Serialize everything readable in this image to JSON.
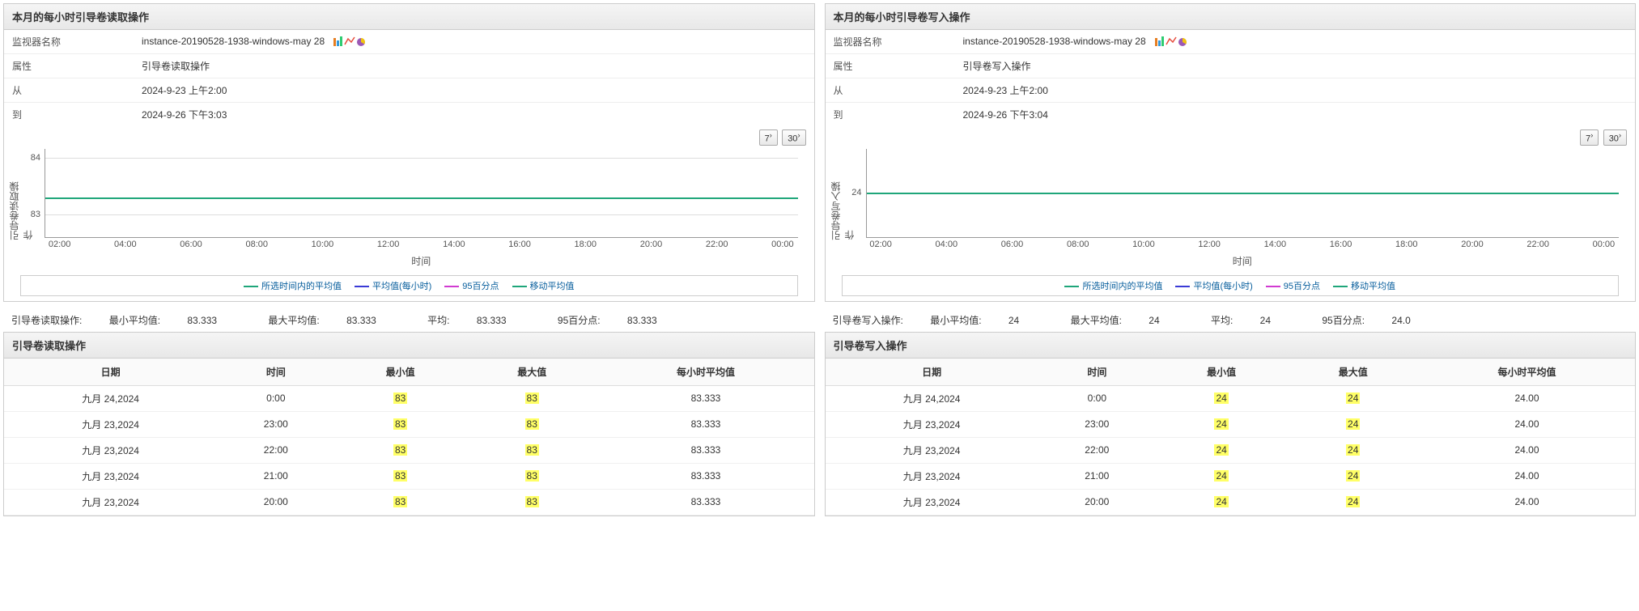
{
  "left": {
    "header": "本月的每小时引导卷读取操作",
    "info": {
      "monitor_label": "监视器名称",
      "monitor_value": "instance-20190528-1938-windows-may 28",
      "attr_label": "属性",
      "attr_value": "引导卷读取操作",
      "from_label": "从",
      "from_value": "2024-9-23 上午2:00",
      "to_label": "到",
      "to_value": "2024-9-26 下午3:03"
    },
    "toolbar": {
      "btn7": "7",
      "btn30": "30"
    },
    "chart": {
      "yaxis_label": "引导卷读取操作",
      "yticks": [
        "83",
        "84"
      ],
      "xticks": [
        "02:00",
        "04:00",
        "06:00",
        "08:00",
        "10:00",
        "12:00",
        "14:00",
        "16:00",
        "18:00",
        "20:00",
        "22:00",
        "00:00"
      ],
      "xlabel": "时间"
    },
    "legend": [
      {
        "label": "所选时间内的平均值",
        "color": "#1fa67a"
      },
      {
        "label": "平均值(每小时)",
        "color": "#3b3bd6"
      },
      {
        "label": "95百分点",
        "color": "#d13bd1"
      },
      {
        "label": "移动平均值",
        "color": "#1fa67a"
      }
    ],
    "stats": {
      "prefix": "引导卷读取操作:",
      "min_label": "最小平均值:",
      "min_value": "83.333",
      "max_label": "最大平均值:",
      "max_value": "83.333",
      "avg_label": "平均:",
      "avg_value": "83.333",
      "p95_label": "95百分点:",
      "p95_value": "83.333"
    },
    "table_header": "引导卷读取操作",
    "columns": {
      "date": "日期",
      "time": "时间",
      "min": "最小值",
      "max": "最大值",
      "havg": "每小时平均值"
    },
    "rows": [
      {
        "date": "九月 24,2024",
        "time": "0:00",
        "min": "83",
        "max": "83",
        "havg": "83.333"
      },
      {
        "date": "九月 23,2024",
        "time": "23:00",
        "min": "83",
        "max": "83",
        "havg": "83.333"
      },
      {
        "date": "九月 23,2024",
        "time": "22:00",
        "min": "83",
        "max": "83",
        "havg": "83.333"
      },
      {
        "date": "九月 23,2024",
        "time": "21:00",
        "min": "83",
        "max": "83",
        "havg": "83.333"
      },
      {
        "date": "九月 23,2024",
        "time": "20:00",
        "min": "83",
        "max": "83",
        "havg": "83.333"
      }
    ]
  },
  "right": {
    "header": "本月的每小时引导卷写入操作",
    "info": {
      "monitor_label": "监视器名称",
      "monitor_value": "instance-20190528-1938-windows-may 28",
      "attr_label": "属性",
      "attr_value": "引导卷写入操作",
      "from_label": "从",
      "from_value": "2024-9-23 上午2:00",
      "to_label": "到",
      "to_value": "2024-9-26 下午3:04"
    },
    "toolbar": {
      "btn7": "7",
      "btn30": "30"
    },
    "chart": {
      "yaxis_label": "引导卷写入操作",
      "yticks": [
        "24"
      ],
      "xticks": [
        "02:00",
        "04:00",
        "06:00",
        "08:00",
        "10:00",
        "12:00",
        "14:00",
        "16:00",
        "18:00",
        "20:00",
        "22:00",
        "00:00"
      ],
      "xlabel": "时间"
    },
    "legend": [
      {
        "label": "所选时间内的平均值",
        "color": "#1fa67a"
      },
      {
        "label": "平均值(每小时)",
        "color": "#3b3bd6"
      },
      {
        "label": "95百分点",
        "color": "#d13bd1"
      },
      {
        "label": "移动平均值",
        "color": "#1fa67a"
      }
    ],
    "stats": {
      "prefix": "引导卷写入操作:",
      "min_label": "最小平均值:",
      "min_value": "24",
      "max_label": "最大平均值:",
      "max_value": "24",
      "avg_label": "平均:",
      "avg_value": "24",
      "p95_label": "95百分点:",
      "p95_value": "24.0"
    },
    "table_header": "引导卷写入操作",
    "columns": {
      "date": "日期",
      "time": "时间",
      "min": "最小值",
      "max": "最大值",
      "havg": "每小时平均值"
    },
    "rows": [
      {
        "date": "九月 24,2024",
        "time": "0:00",
        "min": "24",
        "max": "24",
        "havg": "24.00"
      },
      {
        "date": "九月 23,2024",
        "time": "23:00",
        "min": "24",
        "max": "24",
        "havg": "24.00"
      },
      {
        "date": "九月 23,2024",
        "time": "22:00",
        "min": "24",
        "max": "24",
        "havg": "24.00"
      },
      {
        "date": "九月 23,2024",
        "time": "21:00",
        "min": "24",
        "max": "24",
        "havg": "24.00"
      },
      {
        "date": "九月 23,2024",
        "time": "20:00",
        "min": "24",
        "max": "24",
        "havg": "24.00"
      }
    ]
  },
  "chart_data": [
    {
      "type": "line",
      "title": "本月的每小时引导卷读取操作",
      "xlabel": "时间",
      "ylabel": "引导卷读取操作",
      "ylim": [
        83,
        84
      ],
      "categories": [
        "02:00",
        "04:00",
        "06:00",
        "08:00",
        "10:00",
        "12:00",
        "14:00",
        "16:00",
        "18:00",
        "20:00",
        "22:00",
        "00:00"
      ],
      "series": [
        {
          "name": "所选时间内的平均值",
          "values": [
            83.333,
            83.333,
            83.333,
            83.333,
            83.333,
            83.333,
            83.333,
            83.333,
            83.333,
            83.333,
            83.333,
            83.333
          ]
        },
        {
          "name": "平均值(每小时)",
          "values": [
            83.333,
            83.333,
            83.333,
            83.333,
            83.333,
            83.333,
            83.333,
            83.333,
            83.333,
            83.333,
            83.333,
            83.333
          ]
        },
        {
          "name": "95百分点",
          "values": [
            83.333,
            83.333,
            83.333,
            83.333,
            83.333,
            83.333,
            83.333,
            83.333,
            83.333,
            83.333,
            83.333,
            83.333
          ]
        },
        {
          "name": "移动平均值",
          "values": [
            83.333,
            83.333,
            83.333,
            83.333,
            83.333,
            83.333,
            83.333,
            83.333,
            83.333,
            83.333,
            83.333,
            83.333
          ]
        }
      ]
    },
    {
      "type": "line",
      "title": "本月的每小时引导卷写入操作",
      "xlabel": "时间",
      "ylabel": "引导卷写入操作",
      "ylim": [
        23.5,
        24.5
      ],
      "categories": [
        "02:00",
        "04:00",
        "06:00",
        "08:00",
        "10:00",
        "12:00",
        "14:00",
        "16:00",
        "18:00",
        "20:00",
        "22:00",
        "00:00"
      ],
      "series": [
        {
          "name": "所选时间内的平均值",
          "values": [
            24,
            24,
            24,
            24,
            24,
            24,
            24,
            24,
            24,
            24,
            24,
            24
          ]
        },
        {
          "name": "平均值(每小时)",
          "values": [
            24,
            24,
            24,
            24,
            24,
            24,
            24,
            24,
            24,
            24,
            24,
            24
          ]
        },
        {
          "name": "95百分点",
          "values": [
            24,
            24,
            24,
            24,
            24,
            24,
            24,
            24,
            24,
            24,
            24,
            24
          ]
        },
        {
          "name": "移动平均值",
          "values": [
            24,
            24,
            24,
            24,
            24,
            24,
            24,
            24,
            24,
            24,
            24,
            24
          ]
        }
      ]
    }
  ]
}
